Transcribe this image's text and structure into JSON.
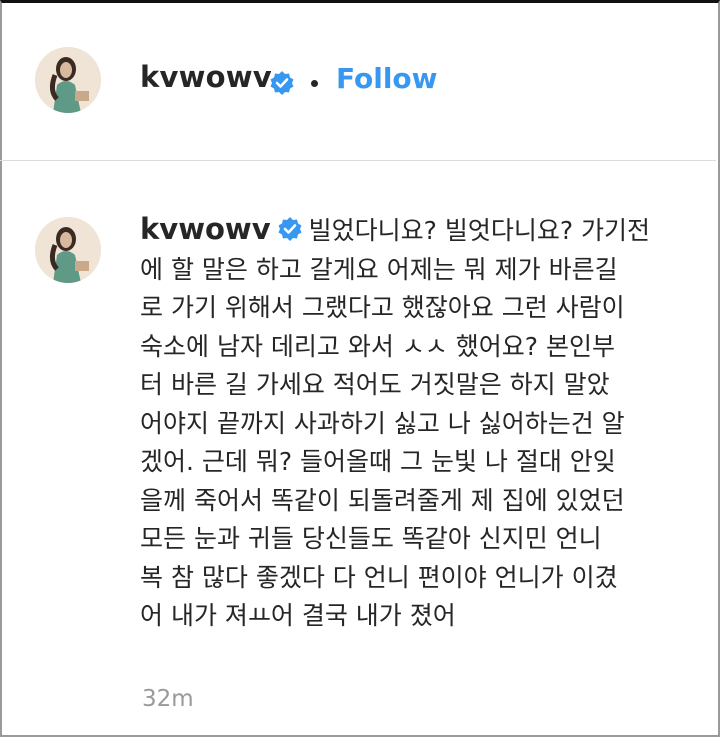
{
  "header": {
    "username": "kvwowv",
    "follow_label": "Follow",
    "separator": "•"
  },
  "comment": {
    "username": "kvwowv",
    "lines": [
      "빌었다니요? 빌엇다니요? 가기전",
      "에 할 말은 하고 갈게요 어제는 뭐 제가 바른길",
      "로 가기 위해서 그랬다고 했잖아요 그런 사람이",
      "숙소에 남자 데리고 와서 ㅅㅅ 했어요? 본인부",
      "터 바른 길 가세요 적어도 거짓말은 하지 말았",
      "어야지 끝까지 사과하기 싫고 나 싫어하는건 알",
      "겠어. 근데 뭐? 들어올때 그 눈빛 나 절대 안잊",
      "을께 죽어서 똑같이 되돌려줄게 제 집에 있었던",
      "모든 눈과 귀들 당신들도 똑같아 신지민 언니",
      "복 참 많다 좋겠다 다 언니 편이야 언니가 이겼",
      "어 내가 져ㅛ어 결국 내가 졌어"
    ],
    "timestamp": "32m"
  },
  "colors": {
    "follow_blue": "#3897f0",
    "verified_blue": "#3897f0",
    "text": "#262626",
    "muted": "#999999"
  },
  "icons": {
    "verified": "verified-badge-icon",
    "avatar": "profile-avatar"
  }
}
